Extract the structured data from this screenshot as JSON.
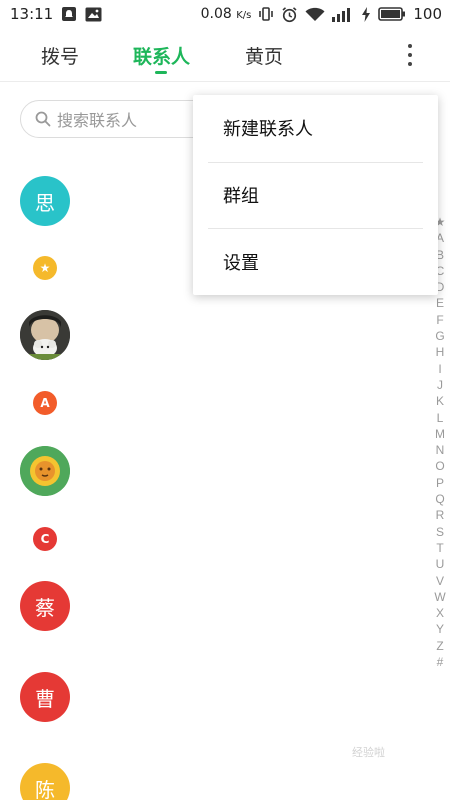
{
  "status_bar": {
    "time": "13:11",
    "net_speed": "0.08",
    "net_unit": "K/s",
    "battery": "100"
  },
  "tabs": [
    {
      "label": "拨号",
      "active": false
    },
    {
      "label": "联系人",
      "active": true
    },
    {
      "label": "黄页",
      "active": false
    }
  ],
  "search": {
    "placeholder": "搜索联系人"
  },
  "contacts": [
    {
      "initial": "思",
      "color": "#29c3c9"
    },
    {
      "initial": "",
      "color": "#3c3c3c",
      "photo": true
    },
    {
      "initial": "",
      "color": "#4fa85b",
      "lion": true
    },
    {
      "initial": "蔡",
      "color": "#e53935"
    },
    {
      "initial": "曹",
      "color": "#e53935"
    },
    {
      "initial": "陈",
      "color": "#f5b92b"
    }
  ],
  "sections": [
    {
      "label": "★",
      "color": "#f5b92b"
    },
    {
      "label": "A",
      "color": "#f25c2a"
    },
    {
      "label": "C",
      "color": "#e53935"
    }
  ],
  "alphabet": [
    "★",
    "A",
    "B",
    "C",
    "D",
    "E",
    "F",
    "G",
    "H",
    "I",
    "J",
    "K",
    "L",
    "M",
    "N",
    "O",
    "P",
    "Q",
    "R",
    "S",
    "T",
    "U",
    "V",
    "W",
    "X",
    "Y",
    "Z",
    "#"
  ],
  "menu": {
    "items": [
      "新建联系人",
      "群组",
      "设置"
    ]
  },
  "colors": {
    "accent": "#1eb65a"
  }
}
